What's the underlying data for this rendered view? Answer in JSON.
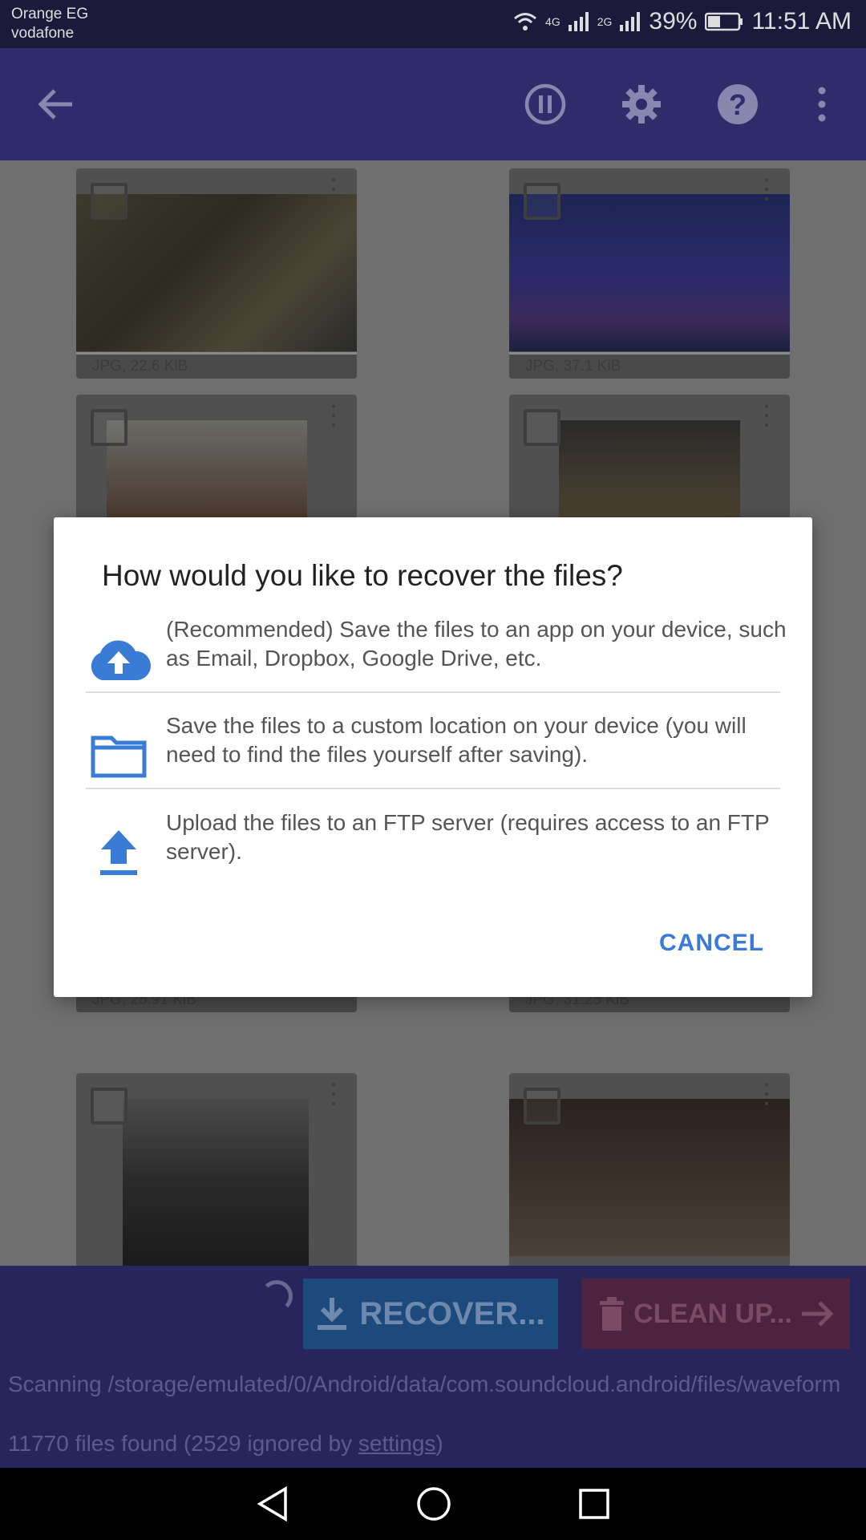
{
  "status_bar": {
    "carrier_1": "Orange EG",
    "carrier_2": "vodafone",
    "net_1": "4G",
    "net_2": "2G",
    "battery": "39%",
    "time": "11:51 AM"
  },
  "toolbar": {
    "back_icon": "arrow-left-icon",
    "pause_icon": "pause-circle-icon",
    "settings_icon": "gear-icon",
    "help_icon": "help-circle-icon",
    "menu_icon": "overflow-menu-icon"
  },
  "tiles": [
    {
      "caption": "JPG, 22.6 KiB"
    },
    {
      "caption": "JPG, 37.1 KiB"
    },
    {
      "caption": ""
    },
    {
      "caption": ""
    },
    {
      "caption": "JPG, 25.91 KiB"
    },
    {
      "caption": "JPG, 31.25 KiB"
    },
    {
      "caption": ""
    },
    {
      "caption": ""
    }
  ],
  "dialog": {
    "title": "How would you like to recover the files?",
    "options": [
      {
        "icon": "cloud-upload-icon",
        "text": "(Recommended) Save the files to an app on your device, such as Email, Dropbox, Google Drive, etc."
      },
      {
        "icon": "folder-icon",
        "text": "Save the files to a custom location on your device (you will need to find the files yourself after saving)."
      },
      {
        "icon": "upload-icon",
        "text": "Upload the files to an FTP server (requires access to an FTP server)."
      }
    ],
    "cancel_label": "CANCEL"
  },
  "actions": {
    "recover_label": "RECOVER...",
    "cleanup_label": "CLEAN UP..."
  },
  "scan": {
    "status": "Scanning /storage/emulated/0/Android/data/com.soundcloud.android/files/waveform",
    "found_prefix": "11770 files found (2529 ignored by ",
    "settings_link": "settings",
    "found_suffix": ")"
  },
  "colors": {
    "accent": "#3a7bd5",
    "toolbar": "#2e2c6b",
    "recover": "#1d4a7c",
    "cleanup": "#4d2340"
  }
}
